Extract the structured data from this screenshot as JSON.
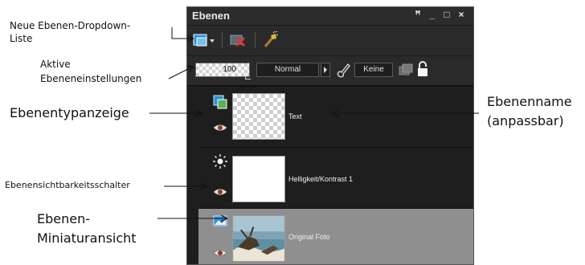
{
  "annotations": {
    "new_layer_dropdown": "Neue Ebenen-Dropdown-\nListe",
    "new_layer_dropdown_line1": "Neue Ebenen-Dropdown-",
    "new_layer_dropdown_line2": "Liste",
    "active_layer_settings_line1": "Aktive",
    "active_layer_settings_line2": "Ebeneneinstellungen",
    "layer_type_indicator": "Ebenentypanzeige",
    "layer_visibility_toggle": "Ebenensichtbarkeitsschalter",
    "layer_thumbnail_line1": "Ebenen-",
    "layer_thumbnail_line2": "Miniaturansicht",
    "layer_name_line1": "Ebenenname",
    "layer_name_line2": "(anpassbar)"
  },
  "panel": {
    "title": "Ebenen",
    "window_buttons": {
      "pin": "ꟸ",
      "minimize": "_",
      "maximize": "□",
      "close": "×"
    }
  },
  "settings": {
    "opacity": "100",
    "blend_mode": "Normal",
    "mask": "Keine"
  },
  "layers": [
    {
      "name": "Text",
      "type_icon": "text-layer-icon",
      "selected": false
    },
    {
      "name": "Helligkeit/Kontrast 1",
      "type_icon": "adjustment-sun-icon",
      "selected": false
    },
    {
      "name": "Original Foto",
      "type_icon": "photo-layer-icon",
      "selected": true
    }
  ],
  "colors": {
    "panel_bg": "#262626",
    "selected_row": "#8f8f8f",
    "title_text": "#e8e8e8"
  }
}
